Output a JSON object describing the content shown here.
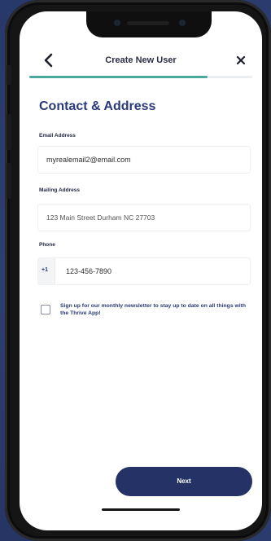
{
  "header": {
    "title": "Create New User",
    "back_icon": "chevron-left-icon",
    "close_icon": "close-icon"
  },
  "progress": {
    "fraction": 0.8,
    "color": "#49a99b"
  },
  "section": {
    "heading": "Contact & Address"
  },
  "form": {
    "email": {
      "label": "Email Address",
      "value": "myrealemail2@email.com"
    },
    "mailing": {
      "label": "Mailing Address",
      "value": "123 Main Street Durham NC 27703"
    },
    "phone": {
      "label": "Phone",
      "prefix": "+1",
      "value": "123-456-7890"
    },
    "newsletter": {
      "label": "Sign up for our monthly newsletter to stay up to date on all things with the Thrive App!",
      "checked": false
    }
  },
  "actions": {
    "next_label": "Next"
  },
  "colors": {
    "brand": "#243266",
    "accent": "#49a99b",
    "heading": "#2b3a78"
  }
}
